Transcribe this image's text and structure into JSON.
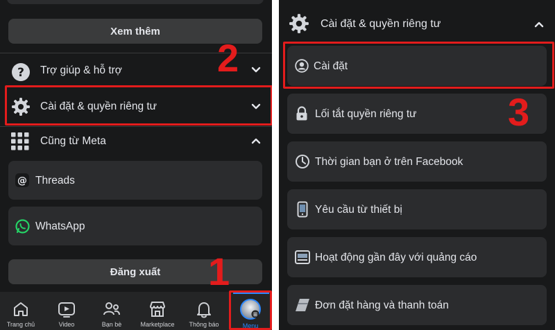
{
  "left": {
    "see_more_label": "Xem thêm",
    "help_label": "Trợ giúp & hỗ trợ",
    "settings_privacy_label": "Cài đặt & quyền riêng tư",
    "also_from_meta_label": "Cũng từ Meta",
    "threads_label": "Threads",
    "whatsapp_label": "WhatsApp",
    "logout_label": "Đăng xuất",
    "nav": [
      {
        "label": "Trang chủ",
        "icon": "home-icon"
      },
      {
        "label": "Video",
        "icon": "video-icon"
      },
      {
        "label": "Bạn bè",
        "icon": "friends-icon"
      },
      {
        "label": "Marketplace",
        "icon": "marketplace-icon"
      },
      {
        "label": "Thông báo",
        "icon": "bell-icon"
      },
      {
        "label": "Menu",
        "icon": "avatar-icon"
      }
    ]
  },
  "right": {
    "header_label": "Cài đặt & quyền riêng tư",
    "items": [
      {
        "label": "Cài đặt",
        "icon": "profile-icon"
      },
      {
        "label": "Lối tắt quyền riêng tư",
        "icon": "lock-icon"
      },
      {
        "label": "Thời gian bạn ở trên Facebook",
        "icon": "clock-icon"
      },
      {
        "label": "Yêu cầu từ thiết bị",
        "icon": "device-icon"
      },
      {
        "label": "Hoạt động gần đây với quảng cáo",
        "icon": "ad-activity-icon"
      },
      {
        "label": "Đơn đặt hàng và thanh toán",
        "icon": "payment-icon"
      }
    ]
  },
  "annotations": {
    "step1": "1",
    "step2": "2",
    "step3": "3"
  },
  "colors": {
    "background": "#18191a",
    "card": "#2b2c2e",
    "text": "#e4e6eb",
    "highlight": "#e31c1c",
    "active_tab": "#2d88ff"
  }
}
